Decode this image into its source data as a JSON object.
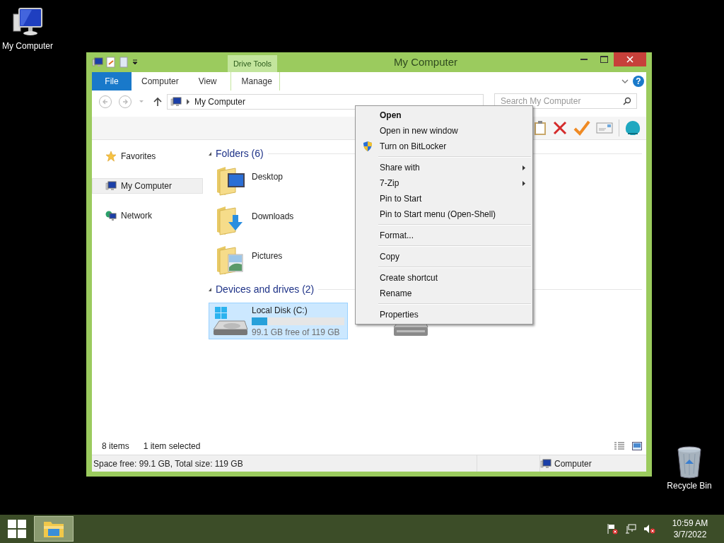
{
  "desktop_icons": [
    {
      "label": "My Computer",
      "kind": "computer"
    },
    {
      "label": "Recycle Bin",
      "kind": "bin"
    }
  ],
  "window": {
    "title": "My Computer",
    "contextual_group": "Drive Tools",
    "ribbon_tabs": [
      {
        "label": "File",
        "kind": "file"
      },
      {
        "label": "Computer",
        "kind": "tab"
      },
      {
        "label": "View",
        "kind": "tab"
      },
      {
        "label": "Manage",
        "kind": "contextual"
      }
    ],
    "address": {
      "path": "My Computer"
    },
    "search": {
      "placeholder": "Search My Computer"
    },
    "help": "?",
    "nav": [
      {
        "label": "Favorites",
        "kind": "star",
        "selected": false
      },
      {
        "label": "My Computer",
        "kind": "computer",
        "selected": true
      },
      {
        "label": "Network",
        "kind": "network",
        "selected": false
      }
    ],
    "groups": [
      {
        "title": "Folders (6)",
        "items": [
          {
            "label": "Desktop",
            "kind": "desktop"
          },
          {
            "label": "Downloads",
            "kind": "downloads"
          },
          {
            "label": "Pictures",
            "kind": "pictures"
          }
        ]
      },
      {
        "title": "Devices and drives (2)",
        "items": [
          {
            "label": "Local Disk (C:)",
            "kind": "disk",
            "level": 0.17,
            "reading": "99.1 GB free of 119 GB",
            "selected": true
          },
          {
            "kind": "optical",
            "selected": false
          }
        ]
      }
    ],
    "status": {
      "items": "8 items",
      "selection": "1 item selected"
    },
    "details_bar": {
      "text": "Space free: 99.1 GB, Total size: 119 GB",
      "location": "Computer"
    }
  },
  "context_menu": {
    "items": [
      {
        "label": "Open",
        "kind": "default"
      },
      {
        "label": "Open in new window",
        "kind": "item"
      },
      {
        "label": "Turn on BitLocker",
        "kind": "shield"
      },
      {
        "kind": "separator"
      },
      {
        "label": "Share with",
        "kind": "submenu"
      },
      {
        "label": "7-Zip",
        "kind": "submenu"
      },
      {
        "label": "Pin to Start",
        "kind": "item"
      },
      {
        "label": "Pin to Start menu (Open-Shell)",
        "kind": "item"
      },
      {
        "kind": "separator"
      },
      {
        "label": "Format...",
        "kind": "item"
      },
      {
        "kind": "separator"
      },
      {
        "label": "Copy",
        "kind": "item"
      },
      {
        "kind": "separator"
      },
      {
        "label": "Create shortcut",
        "kind": "item"
      },
      {
        "label": "Rename",
        "kind": "item"
      },
      {
        "kind": "separator"
      },
      {
        "label": "Properties",
        "kind": "item"
      }
    ]
  },
  "taskbar": {
    "time": "10:59 AM",
    "date": "3/7/2022"
  }
}
